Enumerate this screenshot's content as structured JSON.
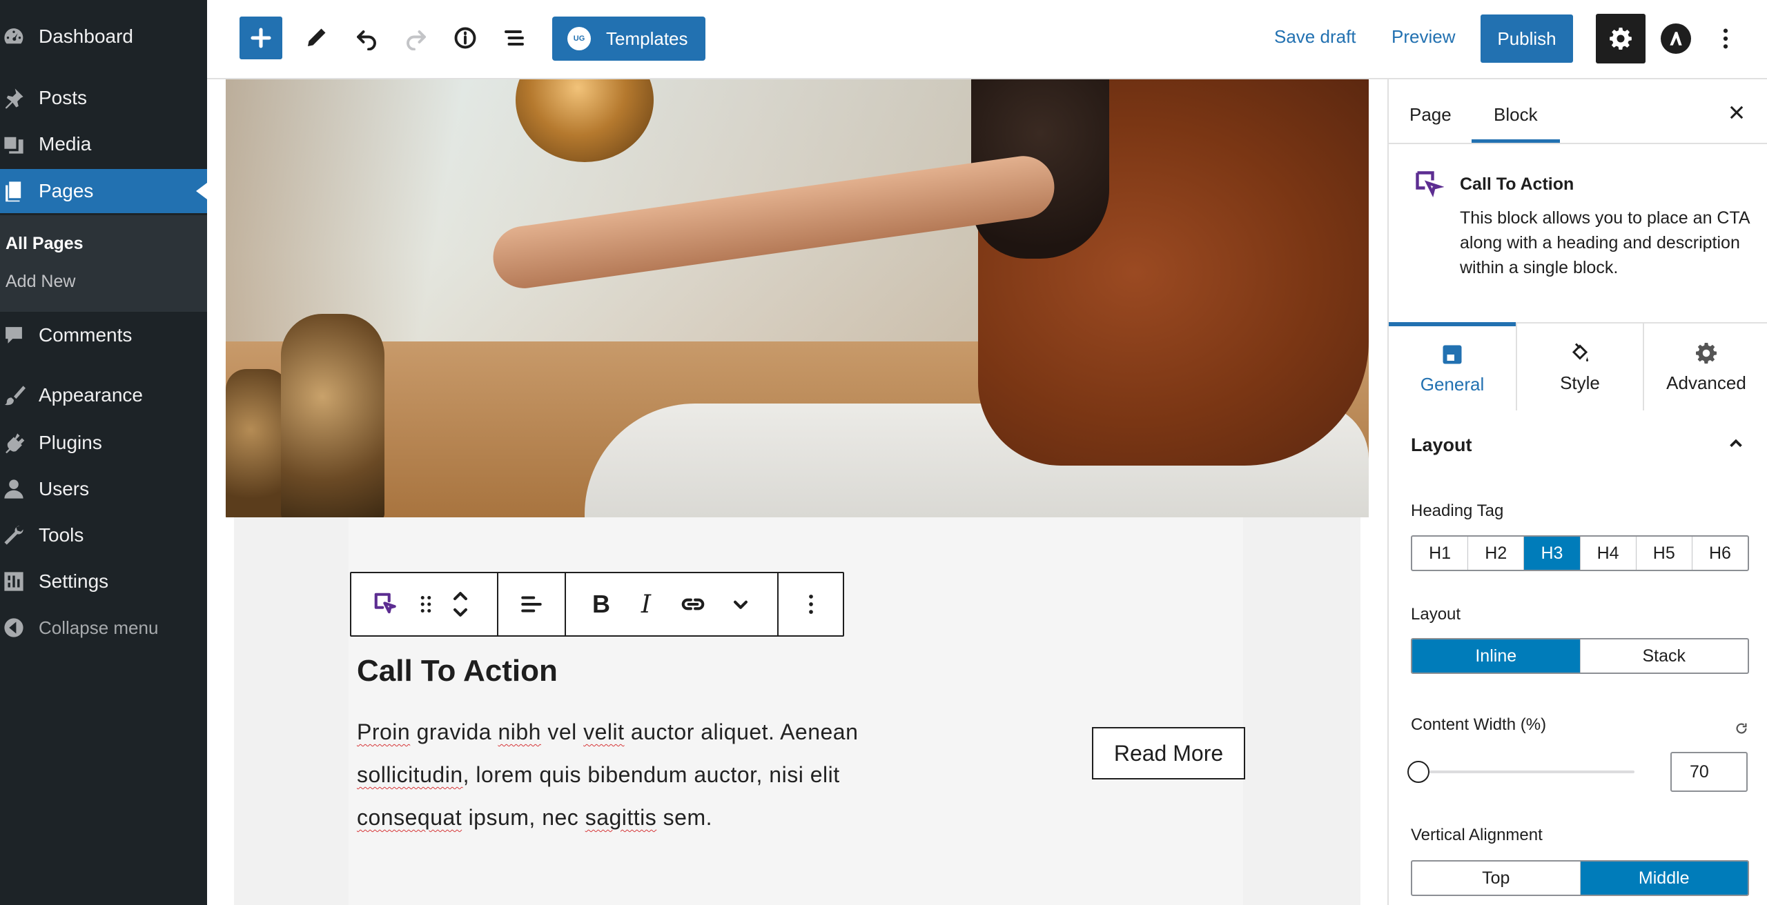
{
  "admin_menu": {
    "items": [
      {
        "label": "Dashboard",
        "icon": "dashboard-icon"
      },
      {
        "label": "Posts",
        "icon": "pin-icon"
      },
      {
        "label": "Media",
        "icon": "media-icon"
      },
      {
        "label": "Pages",
        "icon": "pages-icon"
      },
      {
        "label": "Comments",
        "icon": "comments-icon"
      },
      {
        "label": "Appearance",
        "icon": "brush-icon"
      },
      {
        "label": "Plugins",
        "icon": "plugin-icon"
      },
      {
        "label": "Users",
        "icon": "user-icon"
      },
      {
        "label": "Tools",
        "icon": "wrench-icon"
      },
      {
        "label": "Settings",
        "icon": "settings-icon"
      }
    ],
    "submenu": {
      "all_pages": "All Pages",
      "add_new": "Add New"
    },
    "collapse": "Collapse menu"
  },
  "toolbar": {
    "templates_label": "Templates",
    "ug_badge": "UG",
    "save_draft": "Save draft",
    "preview": "Preview",
    "publish": "Publish",
    "accent": "#2271b1"
  },
  "canvas": {
    "cta_title": "Call To Action",
    "cta_desc_parts": {
      "w1": "Proin",
      "t1": " gravida ",
      "w2": "nibh",
      "t2": " vel ",
      "w3": "velit",
      "t3": " auctor aliquet. Aenean ",
      "w4": "sollicitudin",
      "t4": ", lorem quis bibendum auctor, nisi elit ",
      "w5": "consequat",
      "t5": " ipsum, nec ",
      "w6": "sagittis",
      "t6": " sem."
    },
    "cta_button": "Read More",
    "block_toolbar": {
      "bold": "B",
      "italic": "I"
    }
  },
  "sidebar": {
    "tabs": {
      "page": "Page",
      "block": "Block"
    },
    "block_card": {
      "title": "Call To Action",
      "description": "This block allows you to place an CTA along with a heading and description within a single block."
    },
    "panel_tabs": {
      "general": "General",
      "style": "Style",
      "advanced": "Advanced"
    },
    "layout_section": "Layout",
    "heading_tag": {
      "label": "Heading Tag",
      "options": [
        "H1",
        "H2",
        "H3",
        "H4",
        "H5",
        "H6"
      ],
      "selected": "H3"
    },
    "layout": {
      "label": "Layout",
      "options": [
        "Inline",
        "Stack"
      ],
      "selected": "Inline"
    },
    "content_width": {
      "label": "Content Width (%)",
      "value": "70"
    },
    "vertical_alignment": {
      "label": "Vertical Alignment",
      "options": [
        "Top",
        "Middle"
      ],
      "selected": "Middle"
    }
  }
}
